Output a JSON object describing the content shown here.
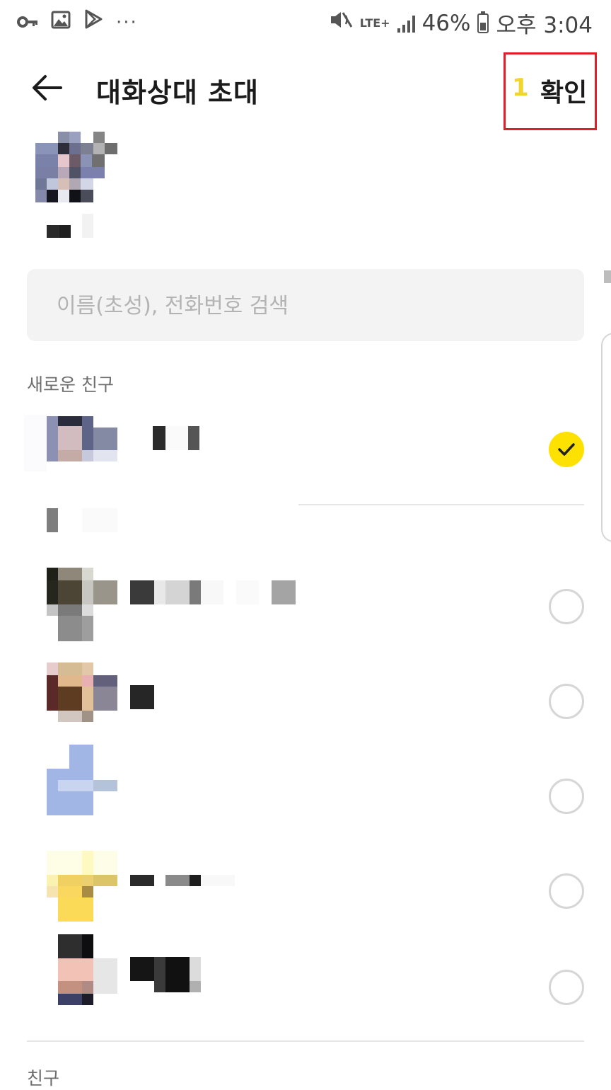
{
  "status_bar": {
    "left_icons": [
      "key-icon",
      "image-icon",
      "play-store-icon",
      "more-icon"
    ],
    "more_glyph": "···",
    "network_type": "LTE+",
    "battery_percent": "46%",
    "time": "오후 3:04"
  },
  "header": {
    "title": "대화상대 초대",
    "selected_count": "1",
    "confirm_label": "확인",
    "highlight_color": "#e01e2a"
  },
  "search": {
    "placeholder": "이름(초성), 전화번호 검색",
    "value": ""
  },
  "sections": {
    "new_friends_label": "새로운 친구",
    "friends_label": "친구"
  },
  "contacts": [
    {
      "selected": true
    },
    {
      "selected": false
    },
    {
      "selected": false
    },
    {
      "selected": false
    },
    {
      "selected": false
    },
    {
      "selected": false
    }
  ],
  "colors": {
    "accent": "#fde100",
    "count": "#f0d52a",
    "search_bg": "#f3f3f3",
    "placeholder": "#b3b3b3"
  }
}
